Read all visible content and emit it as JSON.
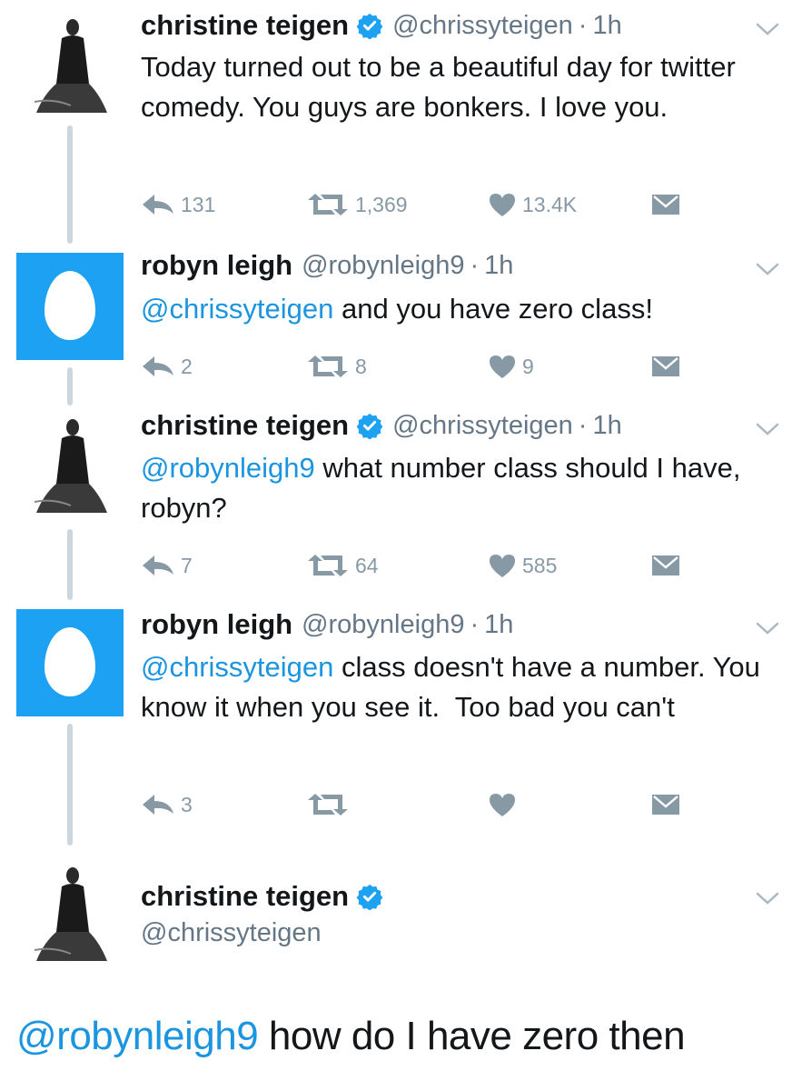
{
  "tweets": [
    {
      "name": "christine teigen",
      "handle": "@chrissyteigen",
      "dot": "·",
      "time": "1h",
      "verified": true,
      "avatar": "portrait-photo",
      "text_mention": "",
      "text": "Today turned out to be a beautiful day for twitter comedy. You guys are bonkers. I love you.",
      "replies": "131",
      "retweets": "1,369",
      "likes": "13.4K"
    },
    {
      "name": "robyn leigh",
      "handle": "@robynleigh9",
      "dot": "·",
      "time": "1h",
      "verified": false,
      "avatar": "default-egg",
      "text_mention": "@chrissyteigen",
      "text": " and you have zero class!",
      "replies": "2",
      "retweets": "8",
      "likes": "9"
    },
    {
      "name": "christine teigen",
      "handle": "@chrissyteigen",
      "dot": "·",
      "time": "1h",
      "verified": true,
      "avatar": "portrait-photo",
      "text_mention": "@robynleigh9",
      "text": " what number class should I have, robyn?",
      "replies": "7",
      "retweets": "64",
      "likes": "585"
    },
    {
      "name": "robyn leigh",
      "handle": "@robynleigh9",
      "dot": "·",
      "time": "1h",
      "verified": false,
      "avatar": "default-egg",
      "text_mention": "@chrissyteigen",
      "text": " class doesn't have a number. You know it when you see it.  Too bad you can't",
      "replies": "3",
      "retweets": "",
      "likes": ""
    },
    {
      "name": "christine teigen",
      "handle": "@chrissyteigen",
      "verified": true,
      "avatar": "portrait-photo"
    }
  ],
  "final_reply": {
    "mention": "@robynleigh9",
    "text": " how do I have zero then"
  },
  "colors": {
    "accent": "#1b95e0",
    "egg_bg": "#1da1f2",
    "verified": "#1da1f2",
    "icon_gray": "#8899a6",
    "text": "#14171a",
    "muted": "#657786"
  },
  "icons": [
    "reply-icon",
    "retweet-icon",
    "like-icon",
    "direct-message-icon",
    "chevron-down-icon",
    "verified-badge-icon"
  ]
}
